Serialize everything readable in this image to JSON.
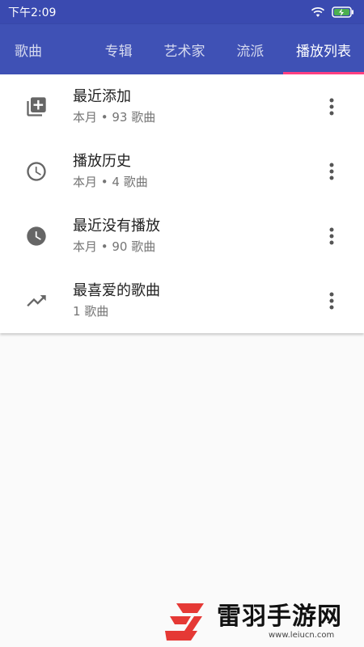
{
  "statusbar": {
    "time": "下午2:09"
  },
  "tabs": [
    {
      "label": "歌曲"
    },
    {
      "label": "专辑"
    },
    {
      "label": "艺术家"
    },
    {
      "label": "流派"
    },
    {
      "label": "播放列表",
      "active": true
    }
  ],
  "playlists": [
    {
      "title": "最近添加",
      "subtitle": "本月 • 93 歌曲",
      "icon": "playlist-add-icon"
    },
    {
      "title": "播放历史",
      "subtitle": "本月 • 4 歌曲",
      "icon": "clock-outline-icon"
    },
    {
      "title": "最近没有播放",
      "subtitle": "本月 • 90 歌曲",
      "icon": "clock-filled-icon"
    },
    {
      "title": "最喜爱的歌曲",
      "subtitle": "1 歌曲",
      "icon": "trending-up-icon"
    }
  ],
  "watermark": {
    "name": "雷羽手游网",
    "url": "www.leiucn.com"
  },
  "colors": {
    "appbar": "#3f51b5",
    "statusbar": "#3a4ab0",
    "indicator": "#ff4081",
    "background": "#fafafa"
  }
}
